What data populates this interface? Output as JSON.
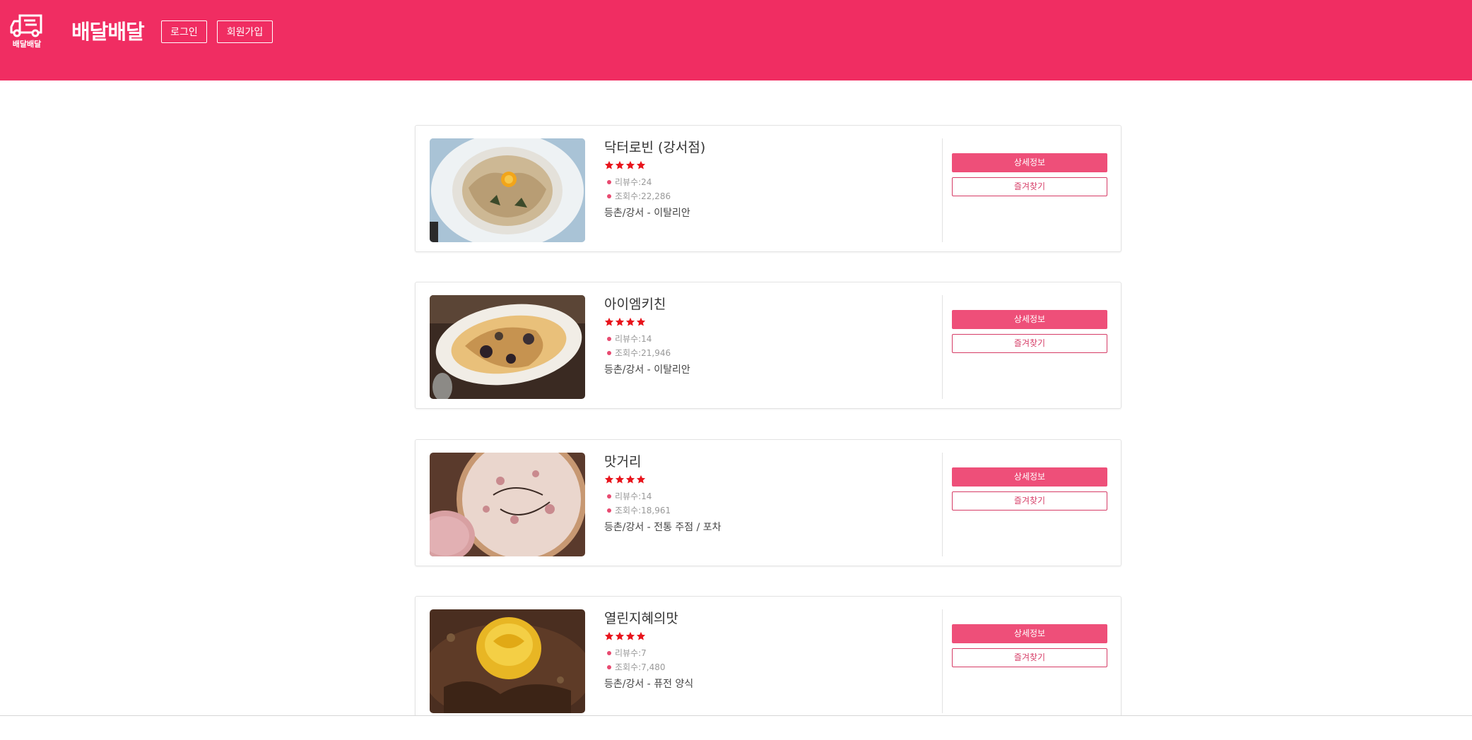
{
  "header": {
    "logo_text": "배달배달",
    "brand": "배달배달",
    "login_label": "로그인",
    "signup_label": "회원가입",
    "background_color": "#f02d62"
  },
  "restaurants": [
    {
      "name": "닥터로빈 (강서점)",
      "rating_stars": 4,
      "reviews": "리뷰수:24",
      "views": "조회수:22,286",
      "location": "등촌/강서 - 이탈리안",
      "detail_label": "상세정보",
      "favorite_label": "즐겨찾기"
    },
    {
      "name": "아이엠키친",
      "rating_stars": 4,
      "reviews": "리뷰수:14",
      "views": "조회수:21,946",
      "location": "등촌/강서 - 이탈리안",
      "detail_label": "상세정보",
      "favorite_label": "즐겨찾기"
    },
    {
      "name": "맛거리",
      "rating_stars": 4,
      "reviews": "리뷰수:14",
      "views": "조회수:18,961",
      "location": "등촌/강서 - 전통 주점 / 포차",
      "detail_label": "상세정보",
      "favorite_label": "즐겨찾기"
    },
    {
      "name": "열린지혜의맛",
      "rating_stars": 4,
      "reviews": "리뷰수:7",
      "views": "조회수:7,480",
      "location": "등촌/강서 - 퓨전 양식",
      "detail_label": "상세정보",
      "favorite_label": "즐겨찾기"
    }
  ],
  "colors": {
    "accent": "#ee4f79",
    "star": "#e8141c"
  }
}
